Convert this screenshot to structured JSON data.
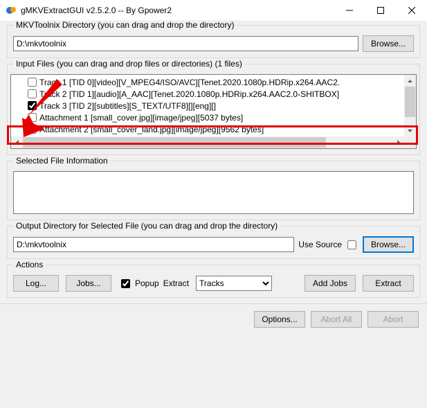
{
  "window": {
    "title": "gMKVExtractGUI v2.5.2.0 -- By Gpower2"
  },
  "mkvtoolnix_group": {
    "label": "MKVToolnix Directory (you can drag and drop the directory)",
    "path": "D:\\mkvtoolnix",
    "browse": "Browse..."
  },
  "input_group": {
    "label": "Input Files (you can drag and drop files or directories) (1 files)",
    "tracks": [
      {
        "checked": false,
        "text": "Track 1 [TID 0][video][V_MPEG4/ISO/AVC][Tenet.2020.1080p.HDRip.x264.AAC2."
      },
      {
        "checked": false,
        "text": "Track 2 [TID 1][audio][A_AAC][Tenet.2020.1080p.HDRip.x264.AAC2.0-SHITBOX]"
      },
      {
        "checked": true,
        "text": "Track 3 [TID 2][subtitles][S_TEXT/UTF8][][eng][]"
      },
      {
        "checked": false,
        "text": "Attachment 1 [small_cover.jpg][image/jpeg][5037 bytes]"
      },
      {
        "checked": false,
        "text": "Attachment 2 [small_cover_land.jpg][image/jpeg][9562 bytes]"
      }
    ]
  },
  "info_group": {
    "label": "Selected File Information"
  },
  "output_group": {
    "label": "Output Directory for Selected File (you can drag and drop the directory)",
    "path": "D:\\mkvtoolnix",
    "use_source": "Use Source",
    "browse": "Browse..."
  },
  "actions_group": {
    "label": "Actions",
    "log": "Log...",
    "jobs": "Jobs...",
    "popup": "Popup",
    "extract_label": "Extract",
    "extract_option": "Tracks",
    "add_jobs": "Add Jobs",
    "extract_btn": "Extract"
  },
  "footer": {
    "options": "Options...",
    "abort_all": "Abort All",
    "abort": "Abort"
  }
}
